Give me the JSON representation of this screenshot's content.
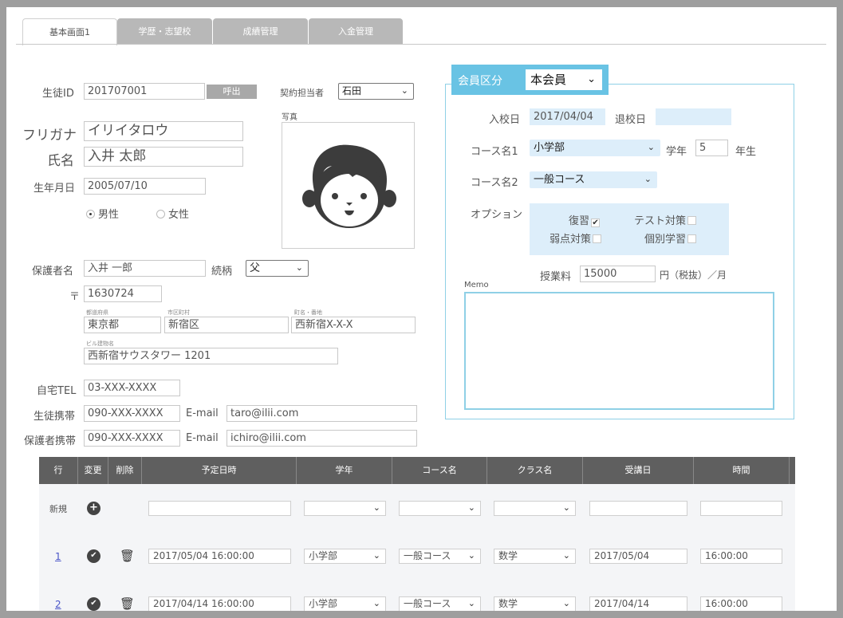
{
  "tabs": [
    {
      "label": "基本画面1",
      "active": true
    },
    {
      "label": "学歴・志望校",
      "active": false
    },
    {
      "label": "成績管理",
      "active": false
    },
    {
      "label": "入金管理",
      "active": false
    }
  ],
  "student": {
    "id_label": "生徒ID",
    "id_value": "201707001",
    "call_button": "呼出",
    "contract_label": "契約担当者",
    "contract_value": "石田",
    "photo_label": "写真",
    "furigana_label": "フリガナ",
    "furigana_value": "イリイタロウ",
    "name_label": "氏名",
    "name_value": "入井 太郎",
    "birth_label": "生年月日",
    "birth_value": "2005/07/10",
    "gender_male": "男性",
    "gender_female": "女性"
  },
  "guardian": {
    "name_label": "保護者名",
    "name_value": "入井 一郎",
    "relation_label": "続柄",
    "relation_value": "父",
    "zip_label": "〒",
    "zip_value": "1630724",
    "pref_label": "都道府県",
    "pref_value": "東京都",
    "city_label": "市区町村",
    "city_value": "新宿区",
    "town_label": "町名・番地",
    "town_value": "西新宿X-X-X",
    "building_label": "ビル建物名",
    "building_value": "西新宿サウスタワー 1201"
  },
  "contact": {
    "home_tel_label": "自宅TEL",
    "home_tel_value": "03-XXX-XXXX",
    "student_mobile_label": "生徒携帯",
    "student_mobile_value": "090-XXX-XXXX",
    "student_email_label": "E-mail",
    "student_email_value": "taro@ilii.com",
    "guardian_mobile_label": "保護者携帯",
    "guardian_mobile_value": "090-XXX-XXXX",
    "guardian_email_label": "E-mail",
    "guardian_email_value": "ichiro@ilii.com"
  },
  "membership": {
    "label": "会員区分",
    "value": "本会員",
    "enroll_label": "入校日",
    "enroll_value": "2017/04/04",
    "leave_label": "退校日",
    "leave_value": "",
    "course1_label": "コース名1",
    "course1_value": "小学部",
    "grade_label": "学年",
    "grade_value": "5",
    "grade_suffix": "年生",
    "course2_label": "コース名2",
    "course2_value": "一般コース",
    "option_label": "オプション",
    "options": [
      {
        "label": "復習",
        "checked": true
      },
      {
        "label": "テスト対策",
        "checked": false
      },
      {
        "label": "弱点対策",
        "checked": false
      },
      {
        "label": "個別学習",
        "checked": false
      }
    ],
    "fee_label": "授業料",
    "fee_value": "15000",
    "fee_suffix": "円（税抜）／月",
    "memo_label": "Memo",
    "memo_value": ""
  },
  "grid": {
    "headers": [
      "行",
      "変更",
      "削除",
      "予定日時",
      "学年",
      "コース名",
      "クラス名",
      "受講日",
      "時間"
    ],
    "new_label": "新規",
    "rows": [
      {
        "num": "1",
        "datetime": "2017/05/04 16:00:00",
        "grade": "小学部",
        "course": "一般コース",
        "class": "数学",
        "date": "2017/05/04",
        "time": "16:00:00"
      },
      {
        "num": "2",
        "datetime": "2017/04/14 16:00:00",
        "grade": "小学部",
        "course": "一般コース",
        "class": "数学",
        "date": "2017/04/14",
        "time": "16:00:00"
      }
    ]
  },
  "colors": {
    "accent": "#69c3e4",
    "panel_border": "#8fd0e6",
    "field_blue": "#ddeefa",
    "grid_header": "#5f5f5f"
  }
}
